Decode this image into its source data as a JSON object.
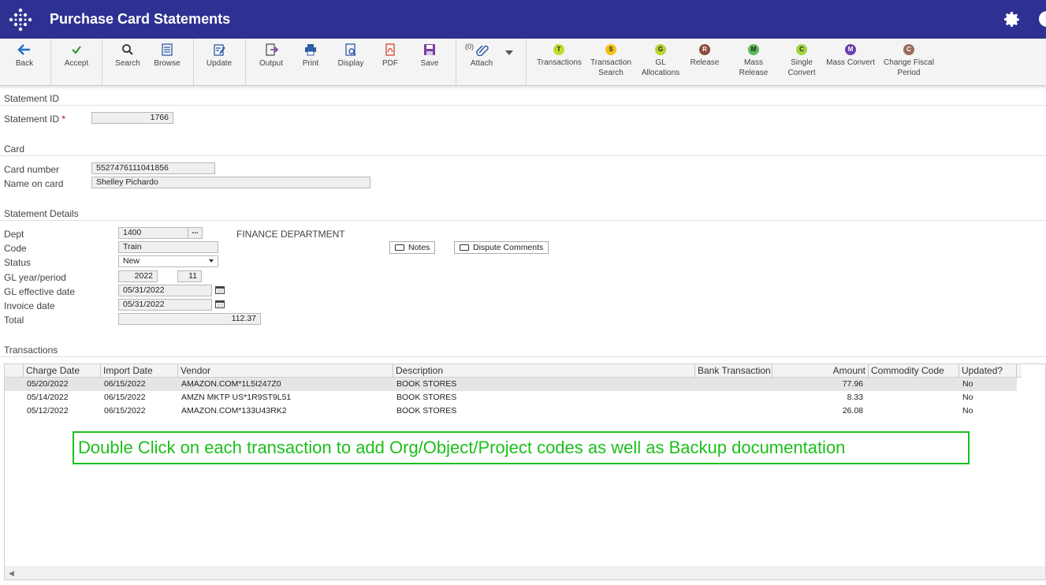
{
  "header": {
    "title": "Purchase Card Statements"
  },
  "toolbar": {
    "back": "Back",
    "accept": "Accept",
    "search": "Search",
    "browse": "Browse",
    "update": "Update",
    "output": "Output",
    "print": "Print",
    "display": "Display",
    "pdf": "PDF",
    "save": "Save",
    "attach": "Attach",
    "attach_count": "(0)",
    "transactions": "Transactions",
    "transactions_letter": "T",
    "transaction_search_1": "Transaction",
    "transaction_search_2": "Search",
    "transaction_search_letter": "S",
    "gl_alloc_1": "GL",
    "gl_alloc_2": "Allocations",
    "gl_alloc_letter": "G",
    "release": "Release",
    "release_letter": "R",
    "mass_release": "Mass Release",
    "mass_release_letter": "M",
    "single_convert_1": "Single",
    "single_convert_2": "Convert",
    "single_convert_letter": "C",
    "mass_convert": "Mass Convert",
    "mass_convert_letter": "M",
    "change_fiscal_1": "Change Fiscal",
    "change_fiscal_2": "Period",
    "change_fiscal_letter": "C"
  },
  "colors": {
    "header_bg": "#2e3192",
    "transactions": "#c3d92f",
    "transaction_search": "#f6c21a",
    "gl_allocations": "#b7d334",
    "release": "#8b4c3a",
    "mass_release": "#5cb85c",
    "single_convert": "#9ed440",
    "mass_convert": "#6a3fb3",
    "change_fiscal": "#9a6b5a",
    "note": "#1bbf1b"
  },
  "statement_id_section": {
    "title": "Statement ID",
    "label": "Statement ID",
    "required": "*",
    "value": "1766"
  },
  "card_section": {
    "title": "Card",
    "card_number_label": "Card number",
    "card_number": "5527476111041856",
    "name_label": "Name on card",
    "name": "Shelley Pichardo"
  },
  "details": {
    "title": "Statement Details",
    "dept_label": "Dept",
    "dept": "1400",
    "dept_lookup": "...",
    "dept_name": "FINANCE DEPARTMENT",
    "code_label": "Code",
    "code": "Train",
    "status_label": "Status",
    "status": "New",
    "gl_label": "GL year/period",
    "gl_year": "2022",
    "gl_period": "11",
    "gl_eff_label": "GL effective date",
    "gl_eff": "05/31/2022",
    "invoice_label": "Invoice date",
    "invoice": "05/31/2022",
    "total_label": "Total",
    "total": "112.37",
    "notes_btn": "Notes",
    "dispute_btn": "Dispute Comments"
  },
  "transactions": {
    "title": "Transactions",
    "columns": [
      "Charge Date",
      "Import Date",
      "Vendor",
      "Description",
      "Bank Transaction",
      "Amount",
      "Commodity Code",
      "Updated?"
    ],
    "rows": [
      {
        "charge": "05/20/2022",
        "import": "06/15/2022",
        "vendor": "AMAZON.COM*1L5I247Z0",
        "desc": "BOOK STORES",
        "bank": "",
        "amount": "77.96",
        "commodity": "",
        "updated": "No"
      },
      {
        "charge": "05/14/2022",
        "import": "06/15/2022",
        "vendor": "AMZN MKTP US*1R9ST9L51",
        "desc": "BOOK STORES",
        "bank": "",
        "amount": "8.33",
        "commodity": "",
        "updated": "No"
      },
      {
        "charge": "05/12/2022",
        "import": "06/15/2022",
        "vendor": "AMAZON.COM*133U43RK2",
        "desc": "BOOK STORES",
        "bank": "",
        "amount": "26.08",
        "commodity": "",
        "updated": "No"
      }
    ]
  },
  "annotation": "Double Click on each transaction to add Org/Object/Project codes as well as Backup documentation"
}
